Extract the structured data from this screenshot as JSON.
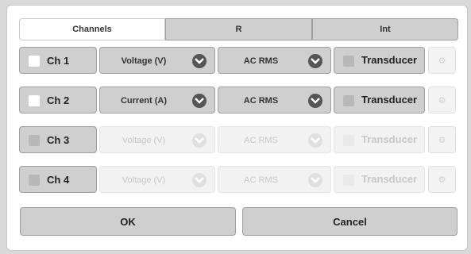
{
  "tabs": [
    "Channels",
    "R",
    "Int"
  ],
  "channels": [
    {
      "label": "Ch 1",
      "measure": "Voltage (V)",
      "mode": "AC RMS",
      "transducer": "Transducer",
      "enabled": true,
      "checked": false
    },
    {
      "label": "Ch 2",
      "measure": "Current (A)",
      "mode": "AC RMS",
      "transducer": "Transducer",
      "enabled": true,
      "checked": false
    },
    {
      "label": "Ch 3",
      "measure": "Voltage (V)",
      "mode": "AC RMS",
      "transducer": "Transducer",
      "enabled": false,
      "checked": false
    },
    {
      "label": "Ch 4",
      "measure": "Voltage (V)",
      "mode": "AC RMS",
      "transducer": "Transducer",
      "enabled": false,
      "checked": false
    }
  ],
  "buttons": {
    "ok": "OK",
    "cancel": "Cancel"
  },
  "icons": {
    "dropdown": "chevron-down-icon",
    "settings": "gear-icon"
  },
  "colors": {
    "control_bg": "#cfcfcf",
    "chevron": "#555555",
    "disabled_bg": "#f2f2f2"
  }
}
